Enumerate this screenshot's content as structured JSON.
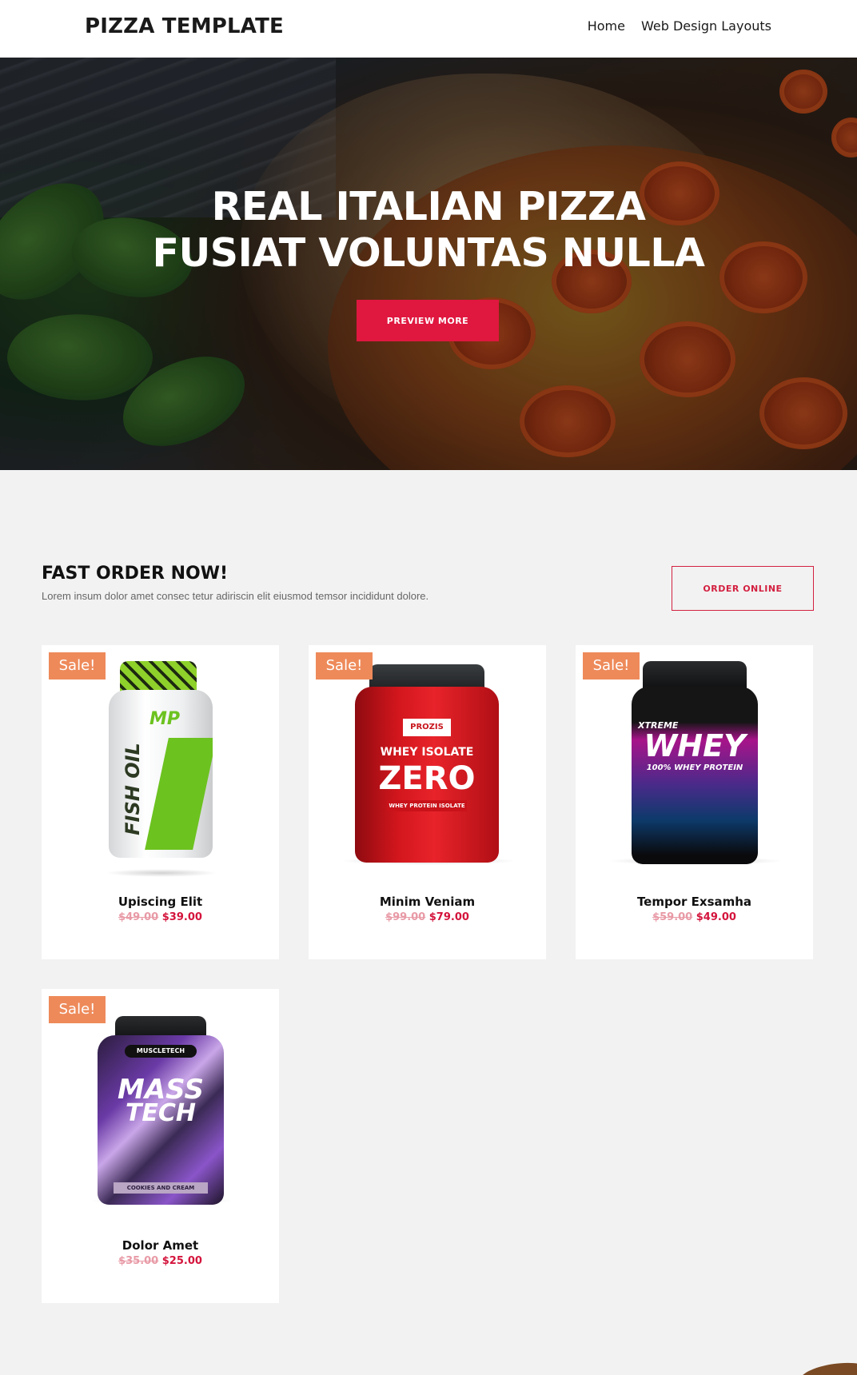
{
  "header": {
    "logo": "PIZZA TEMPLATE",
    "nav": [
      "Home",
      "Web Design Layouts"
    ]
  },
  "hero": {
    "title_line1": "REAL ITALIAN PIZZA",
    "title_line2": "FUSIAT VOLUNTAS NULLA",
    "button": "PREVIEW MORE"
  },
  "order": {
    "title": "FAST ORDER NOW!",
    "subtitle": "Lorem insum dolor amet consec tetur adiriscin elit eiusmod temsor incididunt dolore.",
    "button": "ORDER ONLINE"
  },
  "products": [
    {
      "badge": "Sale!",
      "name": "Upiscing Elit",
      "old_price": "$49.00",
      "new_price": "$39.00",
      "label_lines": [
        "MP",
        "FISH OIL"
      ]
    },
    {
      "badge": "Sale!",
      "name": "Minim Veniam",
      "old_price": "$99.00",
      "new_price": "$79.00",
      "label_lines": [
        "PROZIS",
        "WHEY ISOLATE",
        "ZERO",
        "WHEY PROTEIN ISOLATE"
      ]
    },
    {
      "badge": "Sale!",
      "name": "Tempor Exsamha",
      "old_price": "$59.00",
      "new_price": "$49.00",
      "label_lines": [
        "XTREME",
        "WHEY",
        "100% WHEY PROTEIN"
      ]
    },
    {
      "badge": "Sale!",
      "name": "Dolor Amet",
      "old_price": "$35.00",
      "new_price": "$25.00",
      "label_lines": [
        "MUSCLETECH",
        "MASS",
        "TECH",
        "COOKIES AND CREAM"
      ]
    }
  ],
  "colors": {
    "accent": "#e0173f",
    "sale_badge": "#ee8a5a",
    "old_price": "#e89aa6",
    "new_price": "#d4143c"
  }
}
